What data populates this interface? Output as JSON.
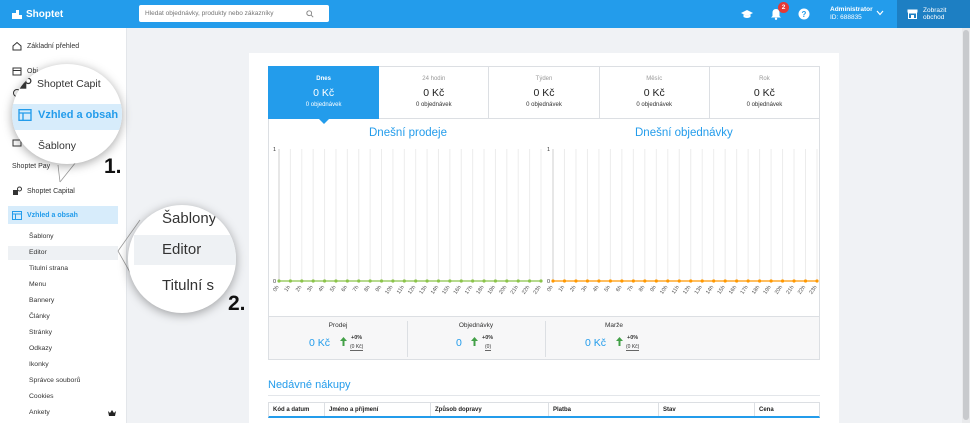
{
  "app": {
    "logo_text": "Shoptet",
    "search_placeholder": "Hledat objednávky, produkty nebo zákazníky",
    "notification_count": "2",
    "user_name": "Administrator",
    "user_id": "ID: 688835",
    "store_button_line1": "Zobrazit",
    "store_button_line2": "obchod"
  },
  "colors": {
    "brand": "#239ceb",
    "sales_series": "#8bc34a",
    "orders_series": "#ff9800",
    "badge": "#e53935",
    "positive_arrow": "#43a047"
  },
  "sidebar": {
    "items": [
      {
        "label": "Základní přehled",
        "icon": "home-icon"
      },
      {
        "label": "Obj",
        "icon": "orders-icon"
      },
      {
        "label": "Shoptet Pay",
        "icon": "pay-icon"
      },
      {
        "label": "Shoptet Capital",
        "icon": "capital-icon"
      },
      {
        "label": "Vzhled a obsah",
        "icon": "layout-icon"
      }
    ],
    "sub_items": [
      "Šablony",
      "Editor",
      "Titulní strana",
      "Menu",
      "Bannery",
      "Články",
      "Stránky",
      "Odkazy",
      "Ikonky",
      "Správce souborů",
      "Cookies",
      "Ankety"
    ],
    "pay_label_visible": "Shoptet Pay"
  },
  "zoom1": {
    "top_label": "Shoptet Capit",
    "active_label": "Vzhled a obsah",
    "sub_label": "Šablony",
    "step": "1."
  },
  "zoom2": {
    "row1": "Šablony",
    "row2": "Editor",
    "row3": "Titulní s",
    "step": "2."
  },
  "tabs": [
    {
      "label": "Dnes",
      "value": "0 Kč",
      "sub": "0 objednávek",
      "active": true
    },
    {
      "label": "24 hodin",
      "value": "0 Kč",
      "sub": "0 objednávek",
      "active": false
    },
    {
      "label": "Týden",
      "value": "0 Kč",
      "sub": "0 objednávek",
      "active": false
    },
    {
      "label": "Měsíc",
      "value": "0 Kč",
      "sub": "0 objednávek",
      "active": false
    },
    {
      "label": "Rok",
      "value": "0 Kč",
      "sub": "0 objednávek",
      "active": false
    }
  ],
  "chart_data": [
    {
      "type": "line",
      "title": "Dnešní prodeje",
      "categories": [
        "0h",
        "1h",
        "2h",
        "3h",
        "4h",
        "5h",
        "6h",
        "7h",
        "8h",
        "9h",
        "10h",
        "11h",
        "12h",
        "13h",
        "14h",
        "15h",
        "16h",
        "17h",
        "18h",
        "19h",
        "20h",
        "21h",
        "22h",
        "23h"
      ],
      "series": [
        {
          "values": [
            0,
            0,
            0,
            0,
            0,
            0,
            0,
            0,
            0,
            0,
            0,
            0,
            0,
            0,
            0,
            0,
            0,
            0,
            0,
            0,
            0,
            0,
            0,
            0
          ]
        }
      ],
      "ylim": [
        0,
        1
      ],
      "yticks": [
        "0",
        "1"
      ],
      "grid": true
    },
    {
      "type": "line",
      "title": "Dnešní objednávky",
      "categories": [
        "0h",
        "1h",
        "2h",
        "3h",
        "4h",
        "5h",
        "6h",
        "7h",
        "8h",
        "9h",
        "10h",
        "11h",
        "12h",
        "13h",
        "14h",
        "15h",
        "16h",
        "17h",
        "18h",
        "19h",
        "20h",
        "21h",
        "22h",
        "23h"
      ],
      "series": [
        {
          "values": [
            0,
            0,
            0,
            0,
            0,
            0,
            0,
            0,
            0,
            0,
            0,
            0,
            0,
            0,
            0,
            0,
            0,
            0,
            0,
            0,
            0,
            0,
            0,
            0
          ]
        }
      ],
      "ylim": [
        0,
        1
      ],
      "yticks": [
        "0",
        "1"
      ],
      "grid": true
    }
  ],
  "stats": [
    {
      "label": "Prodej",
      "value": "0 Kč",
      "pct": "+0%",
      "prev": "(0 Kč)"
    },
    {
      "label": "Objednávky",
      "value": "0",
      "pct": "+0%",
      "prev": "(0)"
    },
    {
      "label": "Marže",
      "value": "0 Kč",
      "pct": "+0%",
      "prev": "(0 Kč)"
    }
  ],
  "recent": {
    "title": "Nedávné nákupy",
    "columns": [
      "Kód a datum",
      "Jméno a příjmení",
      "Způsob dopravy",
      "Platba",
      "Stav",
      "Cena"
    ]
  }
}
